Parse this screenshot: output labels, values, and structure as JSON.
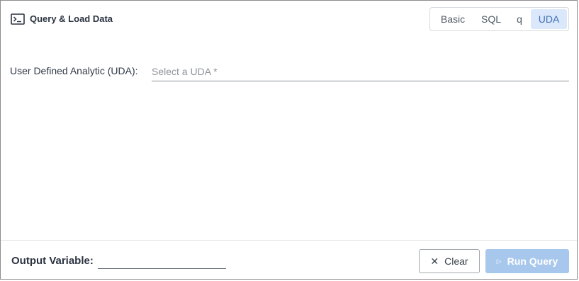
{
  "header": {
    "title": "Query & Load Data",
    "icon": "terminal-icon"
  },
  "modes": {
    "items": [
      "Basic",
      "SQL",
      "q",
      "UDA"
    ],
    "active": "UDA"
  },
  "uda": {
    "label": "User Defined Analytic (UDA):",
    "placeholder": "Select a UDA *"
  },
  "footer": {
    "output_label": "Output Variable:",
    "output_value": "",
    "clear_label": "Clear",
    "clear_icon": "close-icon",
    "run_label": "Run Query",
    "run_icon": "play-icon"
  },
  "colors": {
    "accent": "#3d6fb6",
    "active_tab_bg": "#dbe8fb",
    "run_button_disabled": "#a8c7ec"
  }
}
